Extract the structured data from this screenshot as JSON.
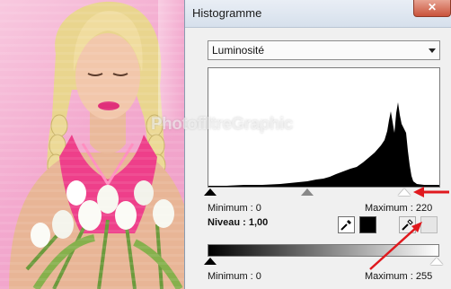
{
  "window": {
    "title": "Histogramme",
    "close_glyph": "✕"
  },
  "channel_select": {
    "value": "Luminosité"
  },
  "input_levels": {
    "min_label": "Minimum : 0",
    "gamma_label": "Niveau : 1,00",
    "max_label": "Maximum : 220",
    "min": 0,
    "gamma": 1.0,
    "max": 220
  },
  "output_levels": {
    "min_label": "Minimum : 0",
    "max_label": "Maximum : 255",
    "min": 0,
    "max": 255
  },
  "watermark": "PhotofiltreGraphic",
  "icons": {
    "eyedropper_black": "eyedropper-icon",
    "swatch_black": "black-swatch",
    "eyedropper_white": "eyedropper-icon",
    "swatch_white": "white-swatch"
  },
  "colors": {
    "annotation_red": "#e0191e",
    "accent_close": "#c9533b"
  }
}
